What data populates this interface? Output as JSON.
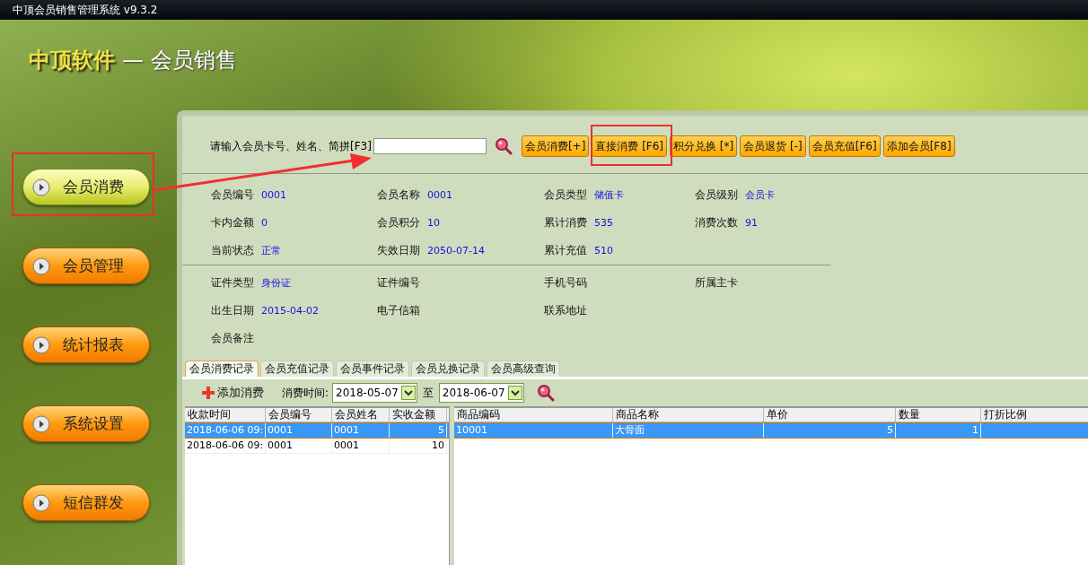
{
  "window": {
    "title": "中顶会员销售管理系统 v9.3.2"
  },
  "banner": {
    "brand": "中顶软件",
    "subtitle": "— 会员销售"
  },
  "sidebar": {
    "items": [
      {
        "label": "会员消费",
        "selected": true
      },
      {
        "label": "会员管理",
        "selected": false
      },
      {
        "label": "统计报表",
        "selected": false
      },
      {
        "label": "系统设置",
        "selected": false
      },
      {
        "label": "短信群发",
        "selected": false
      }
    ]
  },
  "search": {
    "label": "请输入会员卡号、姓名、简拼[F3]"
  },
  "actions": [
    "会员消费[+]",
    "直接消费 [F6]",
    "积分兑换 [*]",
    "会员退货 [-]",
    "会员充值[F6]",
    "添加会员[F8]"
  ],
  "member_info": [
    [
      {
        "label": "会员编号",
        "value": "0001"
      },
      {
        "label": "会员名称",
        "value": "0001"
      },
      {
        "label": "会员类型",
        "value": "储值卡"
      },
      {
        "label": "会员级别",
        "value": "会员卡"
      },
      {
        "label": "卡内金额",
        "value": "0"
      },
      {
        "label": "会员积分",
        "value": "10"
      },
      {
        "label": "累计消费",
        "value": "535"
      },
      {
        "label": "消费次数",
        "value": "91"
      },
      {
        "label": "当前状态",
        "value": "正常"
      },
      {
        "label": "失效日期",
        "value": "2050-07-14"
      },
      {
        "label": "累计充值",
        "value": "510"
      }
    ],
    [
      {
        "label": "证件类型",
        "value": "身份证"
      },
      {
        "label": "证件编号"
      },
      {
        "label": "手机号码"
      },
      {
        "label": "所属主卡"
      },
      {
        "label": "出生日期",
        "value": "2015-04-02"
      },
      {
        "label": "电子信箱"
      },
      {
        "label": "联系地址"
      },
      {
        "label": "会员备注"
      }
    ]
  ],
  "tabs": [
    {
      "label": "会员消费记录",
      "selected": true
    },
    {
      "label": "会员充值记录",
      "selected": false
    },
    {
      "label": "会员事件记录",
      "selected": false
    },
    {
      "label": "会员兑换记录",
      "selected": false
    },
    {
      "label": "会员高级查询",
      "selected": false
    }
  ],
  "filter": {
    "add_label": "添加消费",
    "time_label": "消费时间:",
    "from": "2018-05-07",
    "to_label": "至",
    "to": "2018-06-07"
  },
  "orders": {
    "columns": [
      {
        "label": "收款时间",
        "kind": "text"
      },
      {
        "label": "会员编号",
        "kind": "text"
      },
      {
        "label": "会员姓名",
        "kind": "text"
      },
      {
        "label": "实收金额",
        "kind": "number"
      }
    ],
    "rows": [
      {
        "cells": [
          "2018-06-06 09:",
          "0001",
          "0001",
          "5"
        ],
        "selected": true
      },
      {
        "cells": [
          "2018-06-06 09:",
          "0001",
          "0001",
          "10"
        ],
        "selected": false
      }
    ]
  },
  "items": {
    "columns": [
      {
        "label": "商品编码",
        "kind": "text"
      },
      {
        "label": "商品名称",
        "kind": "text"
      },
      {
        "label": "单价",
        "kind": "number"
      },
      {
        "label": "数量",
        "kind": "number"
      },
      {
        "label": "打折比例",
        "kind": "text"
      }
    ],
    "rows": [
      {
        "cells": [
          "10001",
          "大骨面",
          "5",
          "1",
          ""
        ],
        "selected": true
      }
    ]
  }
}
